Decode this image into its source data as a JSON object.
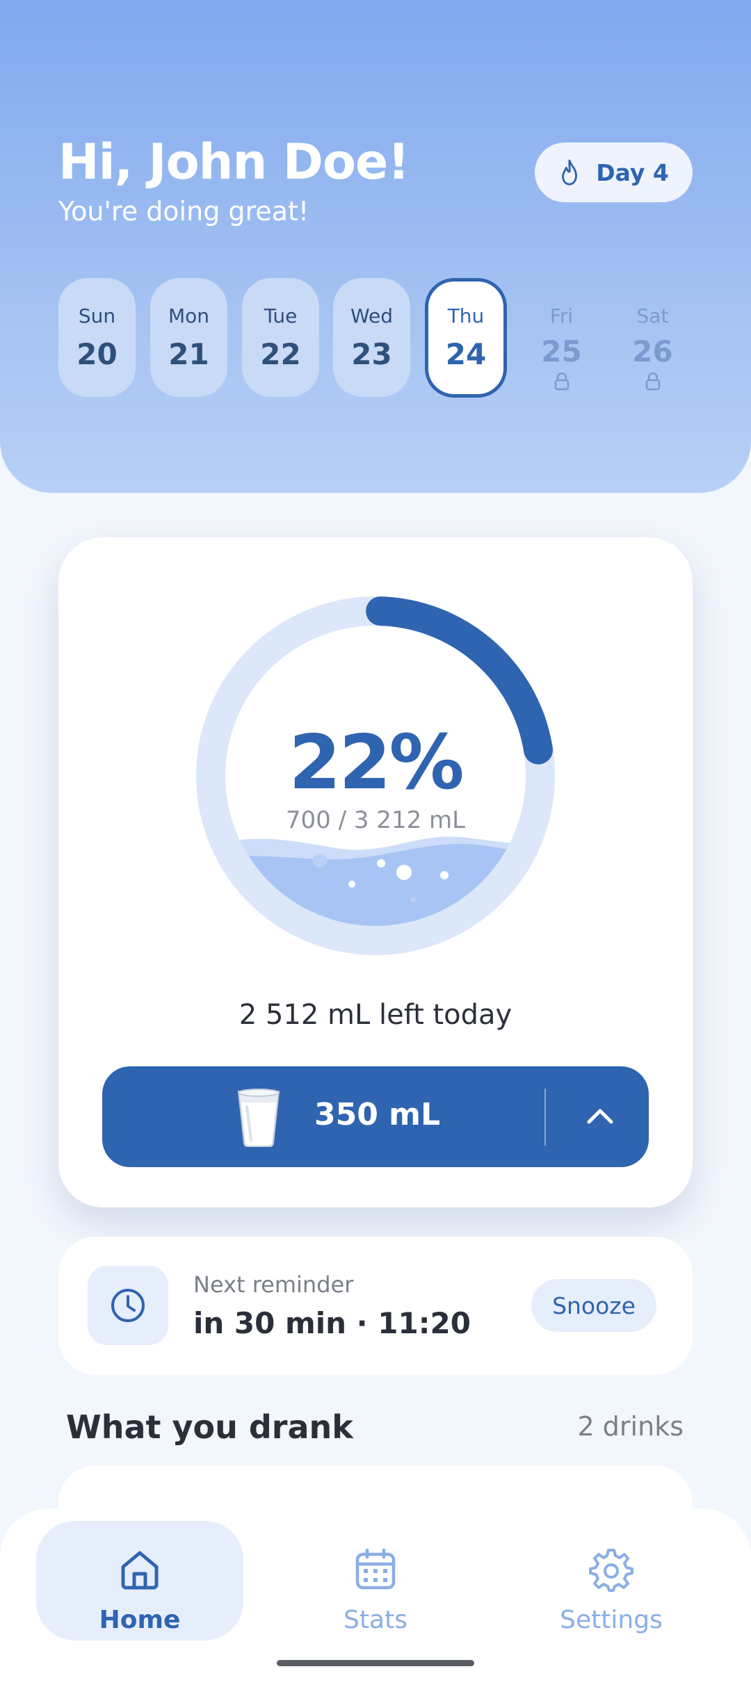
{
  "header": {
    "greeting": "Hi, John Doe!",
    "subtitle": "You're doing great!",
    "streak_label": "Day 4",
    "streak_icon": "flame-icon"
  },
  "week": [
    {
      "name": "Sun",
      "date": "20",
      "state": "done"
    },
    {
      "name": "Mon",
      "date": "21",
      "state": "done"
    },
    {
      "name": "Tue",
      "date": "22",
      "state": "done"
    },
    {
      "name": "Wed",
      "date": "23",
      "state": "done"
    },
    {
      "name": "Thu",
      "date": "24",
      "state": "active"
    },
    {
      "name": "Fri",
      "date": "25",
      "state": "locked"
    },
    {
      "name": "Sat",
      "date": "26",
      "state": "locked"
    }
  ],
  "progress": {
    "percent_label": "22%",
    "percent": 22,
    "volume_label": "700 / 3 212 mL",
    "left_label": "2 512 mL left today"
  },
  "add_button": {
    "amount": "350 mL",
    "icon": "glass-icon"
  },
  "reminder": {
    "label": "Next reminder",
    "time": "in 30 min · 11:20",
    "snooze_label": "Snooze"
  },
  "drinks": {
    "title": "What you drank",
    "count": "2 drinks"
  },
  "nav": [
    {
      "label": "Home",
      "icon": "home-icon",
      "active": true
    },
    {
      "label": "Stats",
      "icon": "calendar-icon",
      "active": false
    },
    {
      "label": "Settings",
      "icon": "gear-icon",
      "active": false
    }
  ],
  "colors": {
    "primary": "#2f64b0",
    "ring_track": "#dce7f9",
    "water": "#a8c4f4",
    "background": "#f2f6fd"
  }
}
